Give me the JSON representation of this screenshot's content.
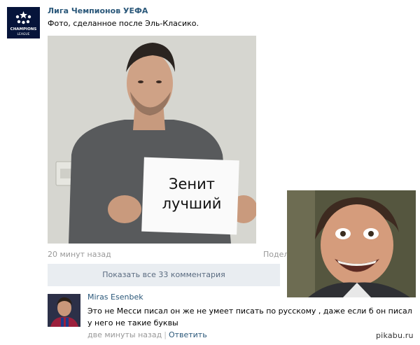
{
  "post": {
    "author": "Лига Чемпионов УЕФА",
    "text": "Фото, сделанное после Эль-Класико.",
    "sign_line1": "Зенит",
    "sign_line2": "лучший",
    "avatar_logo_text": "CHAMPIONS LEAGUE",
    "time": "20 минут назад",
    "share": "Подели",
    "show_comments": "Показать все 33 комментария"
  },
  "comment": {
    "author": "Miras Esenbek",
    "text": "Это не Месси писал он же не умеет писать по русскому , даже если б он писал у него не такие буквы",
    "time": "две минуты назад",
    "separator": "|",
    "reply": "Ответить"
  },
  "watermark": "pikabu.ru",
  "colors": {
    "link": "#2b587a",
    "muted": "#999999",
    "comments_bar": "#e9edf1"
  }
}
